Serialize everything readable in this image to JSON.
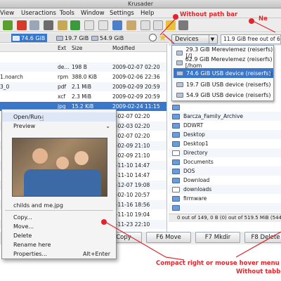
{
  "window": {
    "title": "Krusader"
  },
  "menu": {
    "view": "View",
    "useractions": "Useractions",
    "tools": "Tools",
    "window": "Window",
    "settings": "Settings",
    "help": "Help"
  },
  "devices_bar": {
    "items": [
      {
        "label": "74.6 GiB",
        "active": true
      },
      {
        "label": "19.7 GiB",
        "active": false
      },
      {
        "label": "54.9 GiB",
        "active": false
      }
    ]
  },
  "left_panel": {
    "headers": {
      "ext": "Ext",
      "size": "Size",
      "modified": "Modified"
    },
    "rows": [
      {
        "name": "",
        "ext": "",
        "size": "",
        "modified": ""
      },
      {
        "name": "",
        "ext": "de...",
        "size": "198 B",
        "modified": "2009-02-07 02:20"
      },
      {
        "name": "1.noarch",
        "ext": "rpm",
        "size": "388.0 KiB",
        "modified": "2009-02-06 22:36"
      },
      {
        "name": "3_0",
        "ext": "pdf",
        "size": "2.1 MiB",
        "modified": "2009-02-09 20:59"
      },
      {
        "name": "",
        "ext": "xcf",
        "size": "2.3 MiB",
        "modified": "2009-02-09 20:59"
      },
      {
        "name": "",
        "ext": "jpg",
        "size": "15.2 KiB",
        "modified": "2009-02-24 11:15"
      },
      {
        "name": "",
        "ext": "",
        "size": "",
        "modified": "9-02-07 02:20"
      },
      {
        "name": "",
        "ext": "",
        "size": "",
        "modified": "9-02-03 02:20"
      },
      {
        "name": "",
        "ext": "",
        "size": "",
        "modified": "9-02-07 02:20"
      },
      {
        "name": "",
        "ext": "",
        "size": "",
        "modified": "9-02-09 21:10"
      },
      {
        "name": "",
        "ext": "",
        "size": "",
        "modified": "9-02-09 21:10"
      },
      {
        "name": "",
        "ext": "",
        "size": "",
        "modified": "8-11-10 14:47"
      },
      {
        "name": "",
        "ext": "",
        "size": "",
        "modified": "8-11-10 14:47"
      },
      {
        "name": "",
        "ext": "",
        "size": "",
        "modified": "8-12-07 19:08"
      },
      {
        "name": "",
        "ext": "",
        "size": "",
        "modified": "9-02-10 20:57"
      },
      {
        "name": "",
        "ext": "",
        "size": "",
        "modified": "8-11-16 18:56"
      },
      {
        "name": "",
        "ext": "",
        "size": "",
        "modified": "8-11-10 19:04"
      },
      {
        "name": "",
        "ext": "",
        "size": "",
        "modified": "8-11-23 22:10"
      },
      {
        "name": "",
        "ext": "",
        "size": "",
        "modified": "8-11-10 14:45"
      }
    ]
  },
  "right_panel": {
    "devices_button": "Devices",
    "free_space": "11.9 GiB free out of 62.",
    "device_list": [
      {
        "label": "29.3 GiB Merevlemez (reiserfs) [/]",
        "highlight": false
      },
      {
        "label": "62.9 GiB Merevlemez (reiserfs) [/hom",
        "highlight": false
      },
      {
        "label": "74.6 GiB USB device (reiserfs)",
        "highlight": true
      },
      {
        "label": "19.7 GiB USB device (reiserfs)",
        "highlight": false
      },
      {
        "label": "54.9 GiB USB device (reiserfs)",
        "highlight": false
      }
    ],
    "folders": [
      {
        "name": "",
        "icon": "folder-icon"
      },
      {
        "name": "Barcza_Family_Archive",
        "icon": "folder-icon"
      },
      {
        "name": "DDWRT",
        "icon": "folder-icon"
      },
      {
        "name": "Desktop",
        "icon": "folder-icon"
      },
      {
        "name": "Desktop1",
        "icon": "folder-icon"
      },
      {
        "name": "Directory",
        "icon": "special-folder-icon"
      },
      {
        "name": "Documents",
        "icon": "folder-icon"
      },
      {
        "name": "DOS",
        "icon": "folder-icon"
      },
      {
        "name": "Download",
        "icon": "folder-icon"
      },
      {
        "name": "downloads",
        "icon": "special-folder-icon"
      },
      {
        "name": "firmware",
        "icon": "folder-icon"
      },
      {
        "name": "",
        "icon": "folder-icon"
      }
    ],
    "status": "0 out of 149, 0 B (0) out of 519.5 MiB (544,7"
  },
  "function_keys": {
    "copy": "Copy",
    "move": "F6 Move",
    "mkdir": "F7 Mkdir",
    "delete": "F8 Delete"
  },
  "context_menu": {
    "open_run": "Open/Run",
    "preview": "Preview",
    "filename": "childs and me.jpg",
    "copy": "Copy...",
    "move": "Move...",
    "delete": "Delete",
    "rename": "Rename here",
    "properties": "Properties...",
    "properties_shortcut": "Alt+Enter"
  },
  "annotations": {
    "without_path_bar": "Without path bar",
    "new": "Ne",
    "compact_menu": "Compact right or mouse hover menu",
    "without_tabs": "Without tabb"
  },
  "colors": {
    "selection": "#3a76c9",
    "annotation": "#e0262c"
  }
}
